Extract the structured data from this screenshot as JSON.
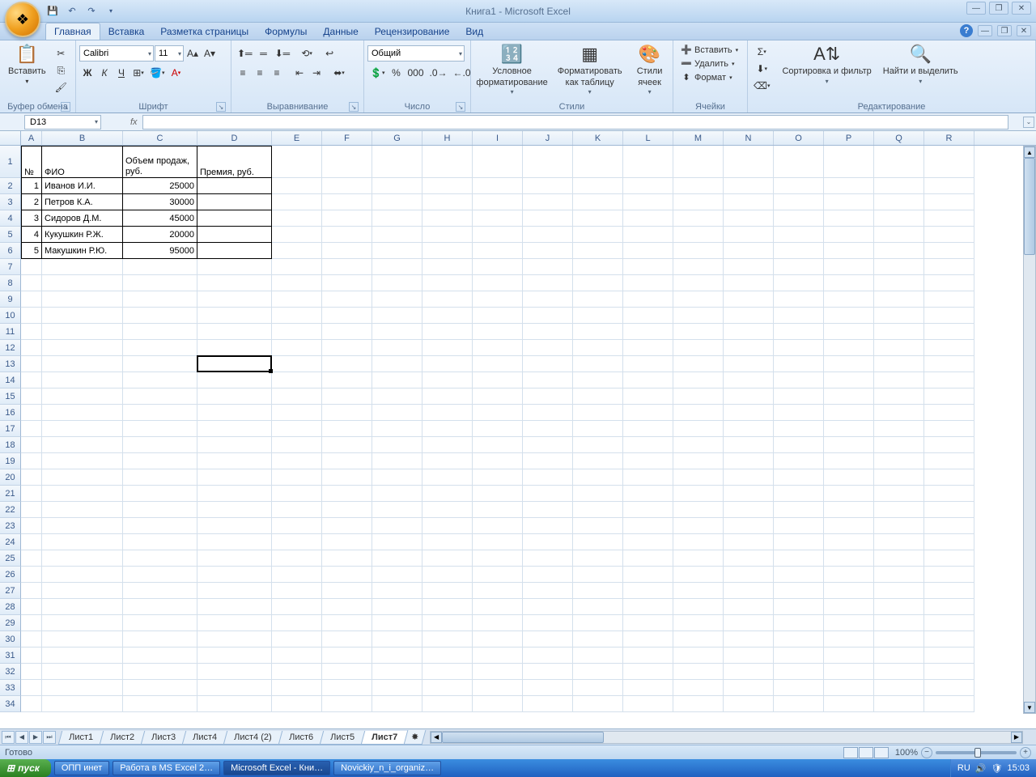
{
  "app": {
    "title": "Книга1 - Microsoft Excel"
  },
  "tabs": {
    "items": [
      "Главная",
      "Вставка",
      "Разметка страницы",
      "Формулы",
      "Данные",
      "Рецензирование",
      "Вид"
    ],
    "active": 0
  },
  "ribbon": {
    "clipboard": {
      "label": "Буфер обмена",
      "paste": "Вставить"
    },
    "font": {
      "label": "Шрифт",
      "name": "Calibri",
      "size": "11",
      "bold": "Ж",
      "italic": "К",
      "underline": "Ч"
    },
    "alignment": {
      "label": "Выравнивание"
    },
    "number": {
      "label": "Число",
      "format": "Общий"
    },
    "styles": {
      "label": "Стили",
      "cond": "Условное форматирование",
      "table": "Форматировать как таблицу",
      "cell": "Стили ячеек"
    },
    "cells": {
      "label": "Ячейки",
      "insert": "Вставить",
      "delete": "Удалить",
      "format": "Формат"
    },
    "editing": {
      "label": "Редактирование",
      "sort": "Сортировка и фильтр",
      "find": "Найти и выделить"
    }
  },
  "namebox": "D13",
  "columns": [
    "A",
    "B",
    "C",
    "D",
    "E",
    "F",
    "G",
    "H",
    "I",
    "J",
    "K",
    "L",
    "M",
    "N",
    "O",
    "P",
    "Q",
    "R"
  ],
  "colwidths": {
    "A": 26,
    "B": 100,
    "C": 92,
    "D": 92,
    "default": 62
  },
  "table": {
    "headers": {
      "a": "№",
      "b": "ФИО",
      "c": "Объем продаж, руб.",
      "d": "Премия, руб."
    },
    "rows": [
      {
        "n": "1",
        "name": "Иванов И.И.",
        "vol": "25000"
      },
      {
        "n": "2",
        "name": "Петров К.А.",
        "vol": "30000"
      },
      {
        "n": "3",
        "name": "Сидоров Д.М.",
        "vol": "45000"
      },
      {
        "n": "4",
        "name": "Кукушкин Р.Ж.",
        "vol": "20000"
      },
      {
        "n": "5",
        "name": "Макушкин Р.Ю.",
        "vol": "95000"
      }
    ]
  },
  "sheets": {
    "items": [
      "Лист1",
      "Лист2",
      "Лист3",
      "Лист4",
      "Лист4 (2)",
      "Лист6",
      "Лист5",
      "Лист7"
    ],
    "active": 7
  },
  "status": {
    "ready": "Готово",
    "zoom": "100%"
  },
  "taskbar": {
    "start": "пуск",
    "items": [
      "ОПП инет",
      "Работа в MS Excel 2…",
      "Microsoft Excel - Кни…",
      "Novickiy_n_i_organiz…"
    ],
    "active": 2,
    "lang": "RU",
    "time": "15:03"
  }
}
